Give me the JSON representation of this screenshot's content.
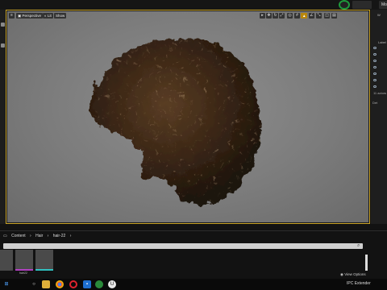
{
  "top_bar": {
    "buttons": [
      "Mo"
    ],
    "colors": {
      "avatar_ring": "#1f9a3c"
    }
  },
  "viewport": {
    "toolbar": {
      "perspective_label": "Perspective",
      "lit_label": "Lit",
      "show_label": "Show"
    },
    "highlight_color": "#c8a227",
    "background_color": "#7c7c7c",
    "subject": "hair-groom"
  },
  "right_panel": {
    "tab_label": "W",
    "label_row": "Label",
    "actors_count": "11 actors",
    "details_label": "Det"
  },
  "content_browser": {
    "breadcrumbs": [
      "Content",
      "Hair",
      "hair-22"
    ],
    "assets": [
      {
        "label": "",
        "accent": ""
      },
      {
        "label": "hair22",
        "accent": "#b040c0"
      },
      {
        "label": "",
        "accent": "#30c0c0"
      }
    ],
    "view_options_label": "View Options"
  },
  "taskbar": {
    "tray_text": "IPC Extender",
    "icons": [
      "windows-icon",
      "search-icon",
      "file-explorer-icon",
      "chrome-icon",
      "opera-icon",
      "settings-icon",
      "unreal-icon"
    ]
  }
}
